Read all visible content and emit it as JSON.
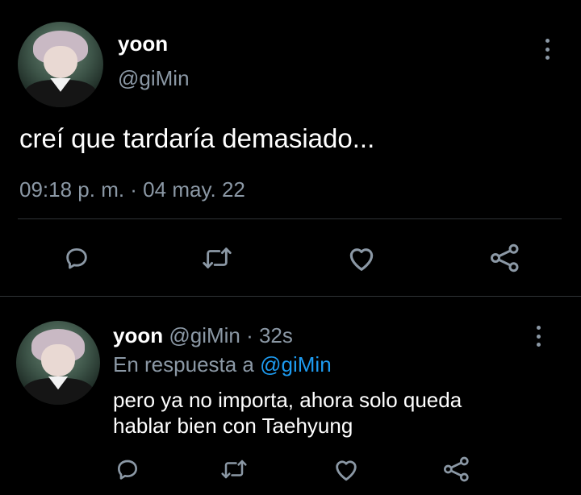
{
  "tweet": {
    "author_name": "yoon",
    "author_handle": "@giMin",
    "text": "creí que tardaría demasiado...",
    "timestamp": "09:18 p. m. · 04 may. 22",
    "avatar_icon": "user-avatar"
  },
  "reply": {
    "author_name": "yoon",
    "meta": "@giMin · 32s",
    "reply_prefix": "En respuesta a",
    "reply_to": "@giMin",
    "text_line1": "pero ya no importa, ahora solo queda",
    "text_line2": "hablar bien con Taehyung",
    "avatar_icon": "user-avatar"
  },
  "actions": [
    "reply-icon",
    "retweet-icon",
    "like-icon",
    "share-icon"
  ],
  "colors": {
    "background": "#000000",
    "text_primary": "#ffffff",
    "text_secondary": "#8b98a5",
    "link": "#1d9bf0",
    "divider": "#2f3336"
  }
}
